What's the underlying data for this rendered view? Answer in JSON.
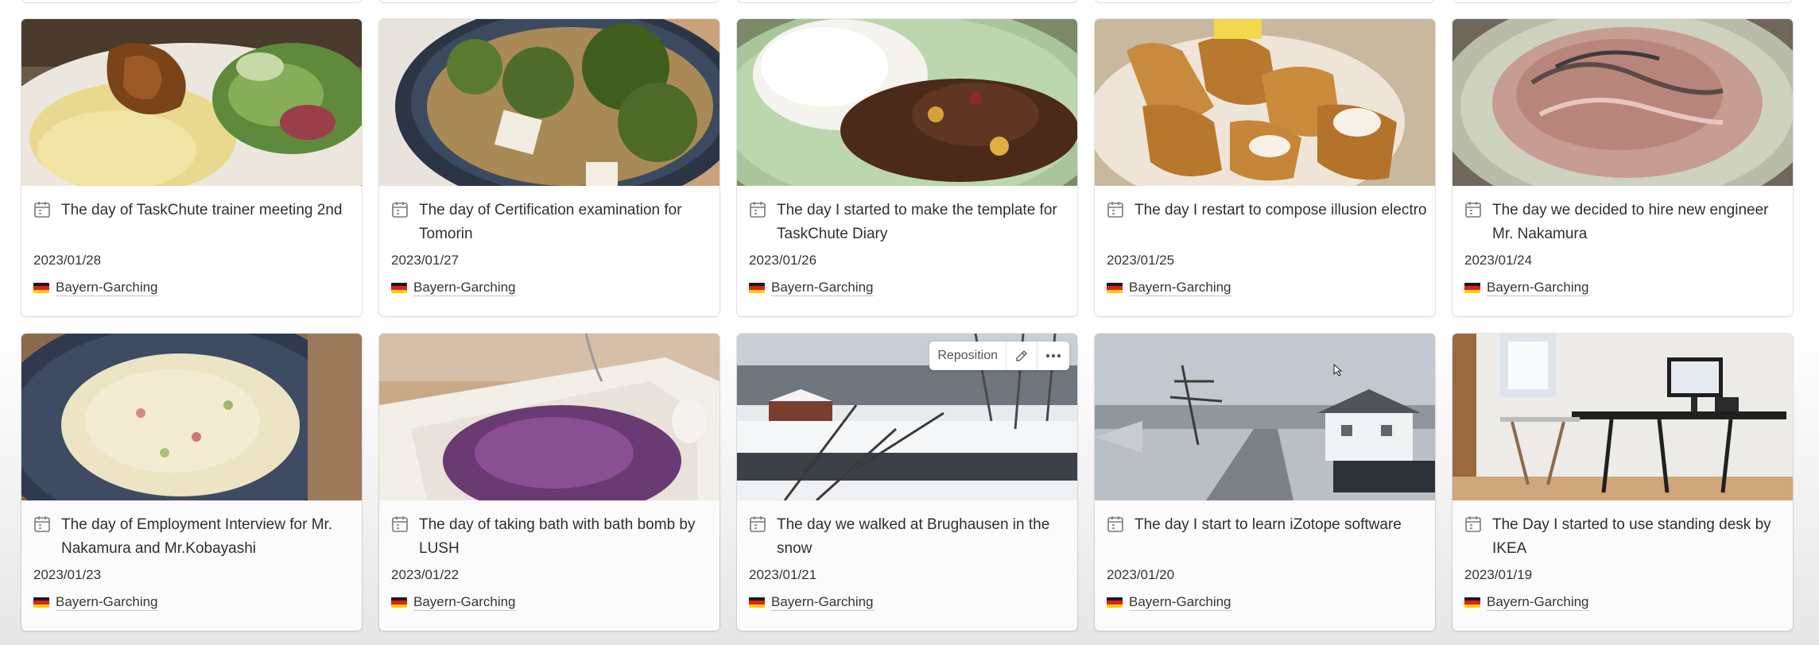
{
  "accent": {
    "flag_black": "#1a1a1a",
    "flag_red": "#dd1f1f",
    "flag_gold": "#ffce00"
  },
  "cards": [
    {
      "title": "The day of TaskChute trainer meeting 2nd",
      "date": "2023/01/28",
      "place": "Bayern-Garching",
      "cover": "food-mash-salad"
    },
    {
      "title": "The day of Certification examination for Tomorin",
      "date": "2023/01/27",
      "place": "Bayern-Garching",
      "cover": "food-broccoli-bowl"
    },
    {
      "title": "The day I started to make the template for TaskChute Diary",
      "date": "2023/01/26",
      "place": "Bayern-Garching",
      "cover": "food-rice-chili"
    },
    {
      "title": "The day I restart to compose illusion electro",
      "date": "2023/01/25",
      "place": "Bayern-Garching",
      "cover": "food-inari"
    },
    {
      "title": "The day we decided to hire new engineer Mr. Nakamura",
      "date": "2023/01/24",
      "place": "Bayern-Garching",
      "cover": "food-noodles"
    },
    {
      "title": "The day of Employment Interview for Mr. Nakamura and Mr.Kobayashi",
      "date": "2023/01/23",
      "place": "Bayern-Garching",
      "cover": "food-fried-rice"
    },
    {
      "title": "The day of taking bath with bath bomb by LUSH",
      "date": "2023/01/22",
      "place": "Bayern-Garching",
      "cover": "bathtub-purple"
    },
    {
      "title": "The day we walked at Brughausen in the snow",
      "date": "2023/01/21",
      "place": "Bayern-Garching",
      "cover": "snow-river",
      "hover": true
    },
    {
      "title": "The day I start to learn iZotope software",
      "date": "2023/01/20",
      "place": "Bayern-Garching",
      "cover": "snow-village"
    },
    {
      "title": "The Day I started to use standing desk by IKEA",
      "date": "2023/01/19",
      "place": "Bayern-Garching",
      "cover": "standing-desk"
    }
  ],
  "cover_toolbar": {
    "reposition_label": "Reposition",
    "edit_icon": "pencil-icon",
    "more_icon": "ellipsis-icon"
  },
  "icons": {
    "page": "calendar-page-icon",
    "flag": "germany-flag-icon"
  }
}
